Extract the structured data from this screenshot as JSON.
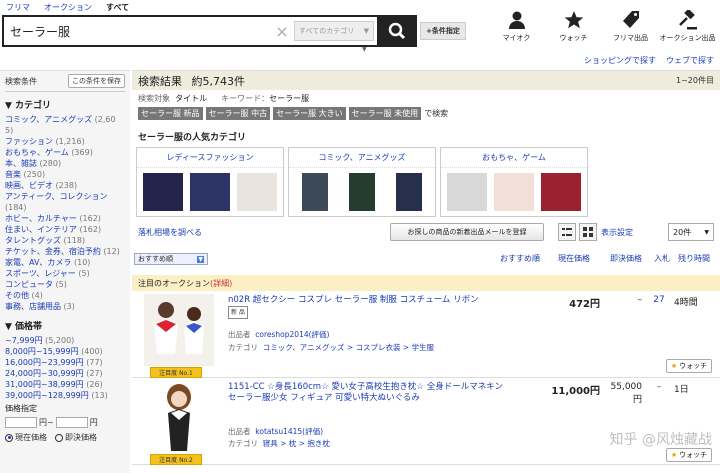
{
  "tabs": [
    "フリマ",
    "オークション",
    "すべて"
  ],
  "search": {
    "query": "セーラー服",
    "category_placeholder": "すべてのカテゴリ",
    "cond_button": "+条件指定"
  },
  "topnav": [
    {
      "label": "マイオク",
      "icon": "person-icon"
    },
    {
      "label": "ウォッチ",
      "icon": "star-icon"
    },
    {
      "label": "フリマ出品",
      "icon": "tag-icon"
    },
    {
      "label": "オークション出品",
      "icon": "hammer-icon"
    }
  ],
  "toplinks": [
    "ショッピングで探す",
    "ウェブで探す"
  ],
  "sidebar": {
    "condition_label": "検索条件",
    "save_label": "この条件を保存",
    "category_title": "▼ カテゴリ",
    "categories": [
      {
        "name": "コミック、アニメグッズ",
        "count": "(2,60\n5)"
      },
      {
        "name": "ファッション",
        "count": "(1,216)"
      },
      {
        "name": "おもちゃ、ゲーム",
        "count": "(369)"
      },
      {
        "name": "本、雑誌",
        "count": "(280)"
      },
      {
        "name": "音楽",
        "count": "(250)"
      },
      {
        "name": "映画、ビデオ",
        "count": "(238)"
      },
      {
        "name": "アンティーク、コレクション",
        "count": "(184)"
      },
      {
        "name": "ホビー、カルチャー",
        "count": "(162)"
      },
      {
        "name": "住まい、インテリア",
        "count": "(162)"
      },
      {
        "name": "タレントグッズ",
        "count": "(118)"
      },
      {
        "name": "チケット、金券、宿泊予約",
        "count": "(12)"
      },
      {
        "name": "家電、AV、カメラ",
        "count": "(10)"
      },
      {
        "name": "スポーツ、レジャー",
        "count": "(5)"
      },
      {
        "name": "コンピュータ",
        "count": "(5)"
      },
      {
        "name": "その他",
        "count": "(4)"
      },
      {
        "name": "事務、店舗用品",
        "count": "(3)"
      }
    ],
    "price_title": "▼ 価格帯",
    "price_ranges": [
      {
        "name": "~7,999円",
        "count": "(5,200)"
      },
      {
        "name": "8,000円~15,999円",
        "count": "(400)"
      },
      {
        "name": "16,000円~23,999円",
        "count": "(77)"
      },
      {
        "name": "24,000円~30,999円",
        "count": "(27)"
      },
      {
        "name": "31,000円~38,999円",
        "count": "(26)"
      },
      {
        "name": "39,000円~128,999円",
        "count": "(13)"
      }
    ],
    "price_input_label": "価格指定",
    "yen": "円~",
    "yen2": "円",
    "radio_current": "現在価格",
    "radio_buynow": "即決価格"
  },
  "main": {
    "result_label": "検索結果",
    "result_count": "約5,743件",
    "range": "1~20件目",
    "target_label": "検索対象",
    "target_value": "タイトル",
    "keyword_label": "キーワード：",
    "keyword_value": "セーラー服",
    "chips": [
      "セーラー服 新品",
      "セーラー服 中古",
      "セーラー服 大きい",
      "セーラー服 未使用"
    ],
    "chips_suffix": "で検索",
    "popular_title": "セーラー服の人気カテゴリ",
    "popular": [
      "レディースファッション",
      "コミック、アニメグッズ",
      "おもちゃ、ゲーム"
    ],
    "market_link": "落札相場を調べる",
    "alert_button": "お探しの商品の新着出品メールを登録",
    "display_settings": "表示設定",
    "per_page": "20件",
    "sort": "おすすめ順",
    "cols": {
      "recommend": "おすすめ順",
      "current": "現在価格",
      "buynow": "即決価格",
      "bids": "入札",
      "left": "残り時間"
    },
    "featured_label": "注目のオークション",
    "featured_detail": "(詳細)",
    "new_tag": "新 品",
    "seller_label": "出品者",
    "category_label": "カテゴリ",
    "watch_label": "ウォッチ"
  },
  "items": [
    {
      "title": "n02R 超セクシー コスプレ セーラー服 制服 コスチューム リボン",
      "seller": "coreshop2014",
      "rating": "(評価)",
      "category": "コミック、アニメグッズ > コスプレ衣装 > 学生服",
      "price": "472円",
      "buynow": "–",
      "bids": "27",
      "left": "4時間",
      "badge": "注目度 No.1"
    },
    {
      "title": "1151-CC ☆身長160cm☆ 愛い女子高校生抱き枕☆ 全身ドールマネキン セーラー服少女 フィギュア 可愛い特大ぬいぐるみ",
      "seller": "kotatsu1415",
      "rating": "(評価)",
      "category": "寝具 > 枕 > 抱き枕",
      "price": "11,000円",
      "buynow": "55,000円",
      "bids": "–",
      "left": "1日",
      "badge": "注目度 No.2"
    }
  ],
  "watermark": "知乎 @风烛藏战"
}
